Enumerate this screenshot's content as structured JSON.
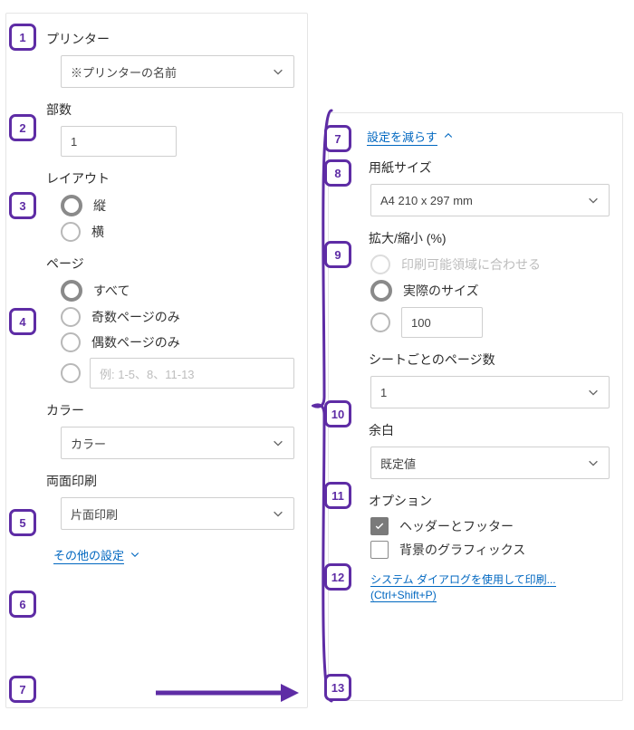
{
  "left": {
    "printer": {
      "label": "プリンター",
      "value": "※プリンターの名前"
    },
    "copies": {
      "label": "部数",
      "value": "1"
    },
    "layout": {
      "label": "レイアウト",
      "portrait": "縦",
      "landscape": "横"
    },
    "pages": {
      "label": "ページ",
      "all": "すべて",
      "odd": "奇数ページのみ",
      "even": "偶数ページのみ",
      "range_placeholder": "例: 1-5、8、11-13"
    },
    "color": {
      "label": "カラー",
      "value": "カラー"
    },
    "duplex": {
      "label": "両面印刷",
      "value": "片面印刷"
    },
    "more": "その他の設定"
  },
  "right": {
    "less": "設定を減らす",
    "paper": {
      "label": "用紙サイズ",
      "value": "A4 210 x 297 mm"
    },
    "scale": {
      "label": "拡大/縮小 (%)",
      "fit": "印刷可能領域に合わせる",
      "actual": "実際のサイズ",
      "custom_value": "100"
    },
    "ppsheet": {
      "label": "シートごとのページ数",
      "value": "1"
    },
    "margins": {
      "label": "余白",
      "value": "既定値"
    },
    "options": {
      "label": "オプション",
      "headers": "ヘッダーとフッター",
      "bg": "背景のグラフィックス"
    },
    "sysdialog": "システム ダイアログを使用して印刷... (Ctrl+Shift+P)"
  },
  "callouts": {
    "n1": "1",
    "n2": "2",
    "n3": "3",
    "n4": "4",
    "n5": "5",
    "n6": "6",
    "n7": "7",
    "n8": "8",
    "n9": "9",
    "n10": "10",
    "n11": "11",
    "n12": "12",
    "n13": "13"
  }
}
